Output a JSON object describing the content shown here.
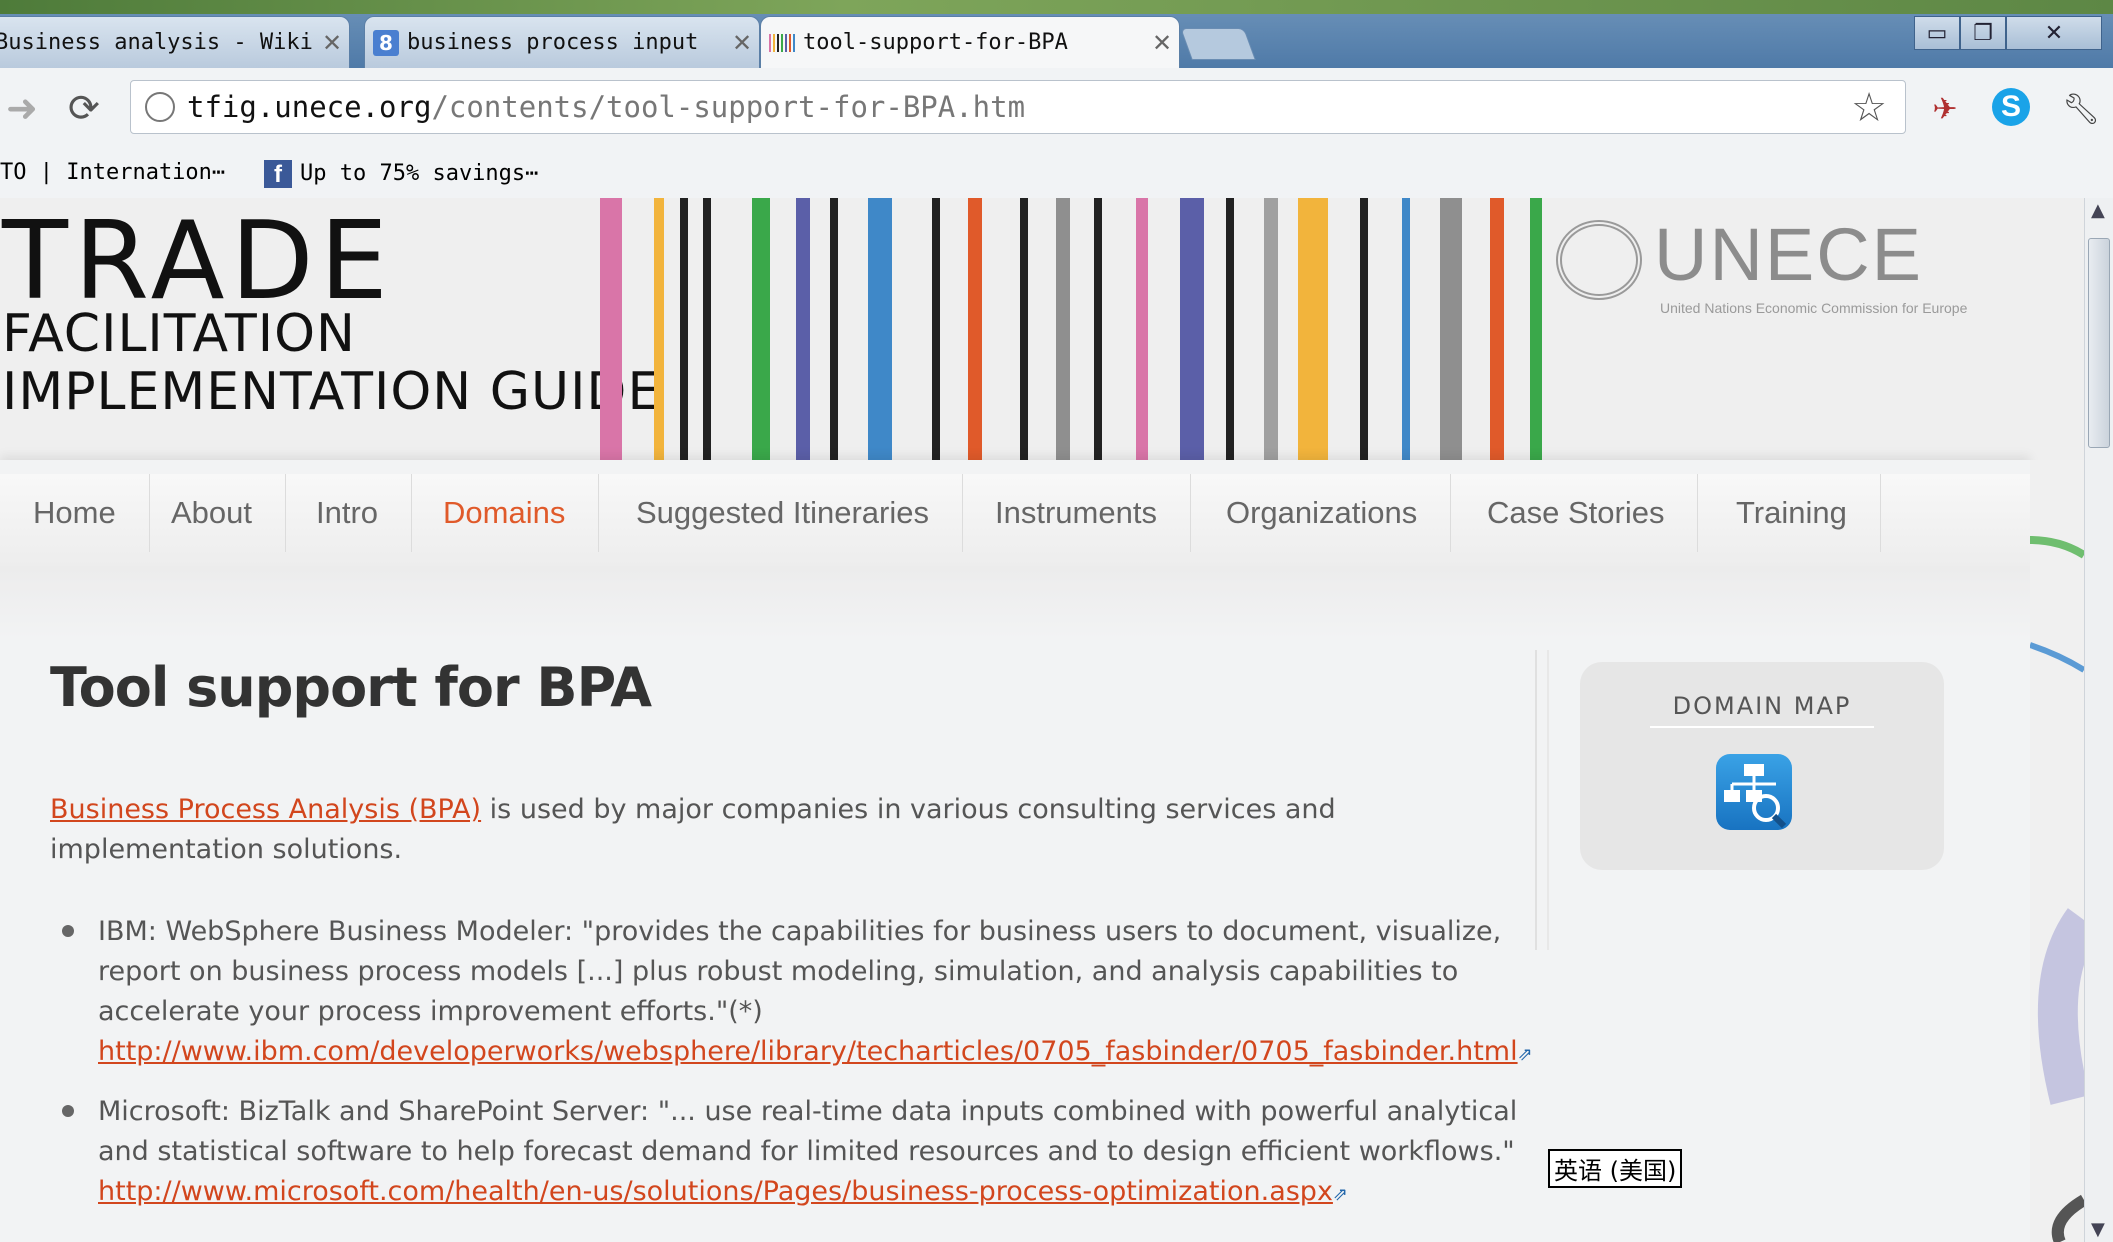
{
  "browser": {
    "tabs": [
      {
        "label": "Business analysis - Wiki",
        "icon": "wikipedia-icon"
      },
      {
        "label": "business process input",
        "icon": "google-icon"
      },
      {
        "label": "tool-support-for-BPA",
        "icon": "tfig-barcode-icon"
      }
    ],
    "address": {
      "host": "tfig.unece.org",
      "path": "/contents/tool-support-for-BPA.htm"
    },
    "bookmarks": [
      {
        "label": "TO | Internation⋯"
      },
      {
        "label": "Up to 75% savings⋯",
        "icon": "facebook-icon"
      }
    ]
  },
  "banner": {
    "line1": "TRADE",
    "line2": "FACILITATION",
    "line3": "IMPLEMENTATION GUIDE",
    "org_name": "UNECE",
    "org_subtitle": "United Nations Economic Commission for Europe",
    "stripe_colors": [
      "#d975a8",
      "#f2b43c",
      "#222222",
      "#222222",
      "#3aa84a",
      "#5b5fa8",
      "#222222",
      "#3f88c8",
      "#222222",
      "#e05a2a",
      "#222222",
      "#8f8f8f",
      "#222222",
      "#d975a8",
      "#5b5fa8",
      "#222222",
      "#a0a0a0",
      "#f2b43c",
      "#222222",
      "#3f88c8",
      "#8f8f8f",
      "#e05a2a",
      "#3aa84a"
    ]
  },
  "menu": [
    "Home",
    "About",
    "Intro",
    "Domains",
    "Suggested Itineraries",
    "Instruments",
    "Organizations",
    "Case Stories",
    "Training"
  ],
  "menu_active": "Domains",
  "article": {
    "title": "Tool support for BPA",
    "intro_link": "Business Process Analysis (BPA)",
    "intro_rest": " is used by major companies in various consulting services and implementation solutions.",
    "items": [
      {
        "text": "IBM: WebSphere Business Modeler: \"provides the capabilities for business users to document, visualize, report on business process models [...] plus robust modeling, simulation, and analysis capabilities to accelerate your process improvement efforts.\"(*)",
        "url": "http://www.ibm.com/developerworks/websphere/library/techarticles/0705_fasbinder/0705_fasbinder.html"
      },
      {
        "text": "Microsoft: BizTalk and SharePoint Server: \"... use real-time data inputs combined with powerful analytical and statistical software to help forecast demand for limited resources and to design efficient workflows.\"",
        "url": "http://www.microsoft.com/health/en-us/solutions/Pages/business-process-optimization.aspx"
      }
    ]
  },
  "sidebar": {
    "domain_map_title": "DOMAIN MAP"
  },
  "ime_indicator": "英语 (美国)",
  "colors": {
    "accent": "#e05a2a",
    "link": "#d2461d"
  }
}
